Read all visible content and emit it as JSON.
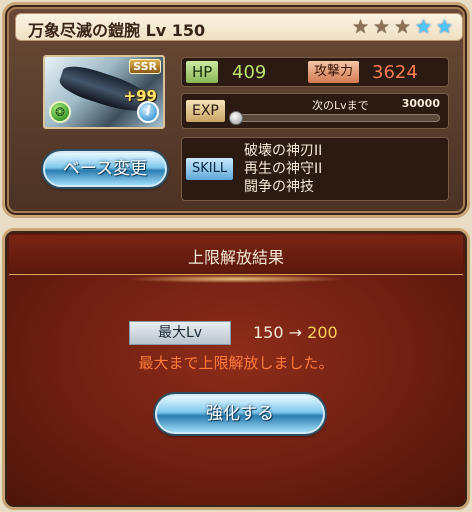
{
  "weapon": {
    "name": "万象尽滅の鎧腕",
    "level_text": "Lv 150",
    "stars": {
      "bronze": 3,
      "blue": 2
    },
    "rarity": "SSR",
    "plus": "+99",
    "element_icon": "wind-element-icon",
    "info_icon": "i"
  },
  "stats": {
    "hp_label": "HP",
    "hp_value": "409",
    "atk_label": "攻撃力",
    "atk_value": "3624",
    "exp_label": "EXP",
    "exp_next_text": "次のLvまで",
    "exp_next_value": "30000",
    "exp_progress": 0
  },
  "base_button_label": "ベース変更",
  "skill": {
    "label": "SKILL",
    "items": [
      "破壊の神刃II",
      "再生の神守II",
      "闘争の神技"
    ]
  },
  "dialog": {
    "title": "上限解放結果",
    "max_lv_label": "最大Lv",
    "lv_old": "150",
    "arrow": "→",
    "lv_new": "200",
    "message": "最大まで上限解放しました。",
    "enhance_button_label": "強化する"
  },
  "colors": {
    "hp": "#b9e36a",
    "atk": "#ff7a50",
    "message": "#ff7a3a",
    "lv_new": "#ffcf5a",
    "frame": "#c9a57a"
  }
}
